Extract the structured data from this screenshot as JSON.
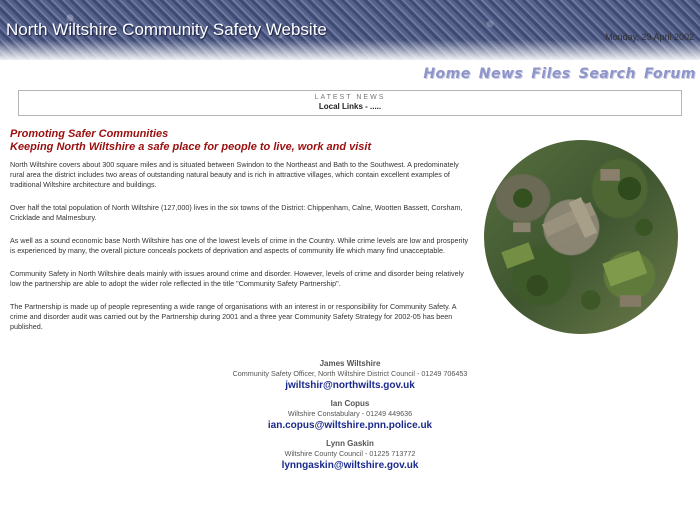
{
  "header": {
    "site_title": "North Wiltshire Community Safety Website",
    "date": "Monday, 29 April 2002"
  },
  "nav": {
    "items": [
      {
        "label": "Home"
      },
      {
        "label": "News"
      },
      {
        "label": "Files"
      },
      {
        "label": "Search"
      },
      {
        "label": "Forum"
      }
    ]
  },
  "news": {
    "title": "LATEST NEWS",
    "links": "Local Links - ....."
  },
  "main": {
    "heading_line1": "Promoting Safer Communities",
    "heading_line2": "Keeping North Wiltshire a safe place for people to live, work and visit",
    "paragraphs": [
      "North Wiltshire covers about 300 square miles and is situated between Swindon to the Northeast and Bath to the Southwest. A predominately rural area the district includes two areas of outstanding natural beauty and is rich in attractive villages, which contain excellent examples of traditional Wiltshire architecture and buildings.",
      "Over half the total population of North Wiltshire (127,000) lives in the six towns of the District: Chippenham, Calne, Wootten Bassett, Corsham, Cricklade and Malmesbury.",
      "As well as a sound economic base North Wiltshire has one of the lowest levels of crime in the Country. While crime levels are low and prosperity is experienced by many, the overall picture conceals pockets of deprivation and aspects of community life which many find unacceptable.",
      "Community Safety in North Wiltshire deals mainly with issues around crime and disorder. However, levels of crime and disorder being relatively low the partnership are able to adopt the wider role reflected in the title \"Community Safety Partnership\".",
      "The Partnership is made up of people representing a wide range of organisations with an interest in or responsibility for Community Safety. A crime and disorder audit was carried out by the Partnership during 2001 and a three year Community Safety Strategy for 2002-05 has been published."
    ]
  },
  "contacts": [
    {
      "name": "James Wiltshire",
      "role": "Community Safety Officer, North Wiltshire District Council - 01249 706453",
      "email": "jwiltshir@northwilts.gov.uk"
    },
    {
      "name": "Ian Copus",
      "role": "Wiltshire Constabulary - 01249 449636",
      "email": "ian.copus@wiltshire.pnn.police.uk"
    },
    {
      "name": "Lynn Gaskin",
      "role": "Wiltshire County Council - 01225 713772",
      "email": "lynngaskin@wiltshire.gov.uk"
    }
  ]
}
